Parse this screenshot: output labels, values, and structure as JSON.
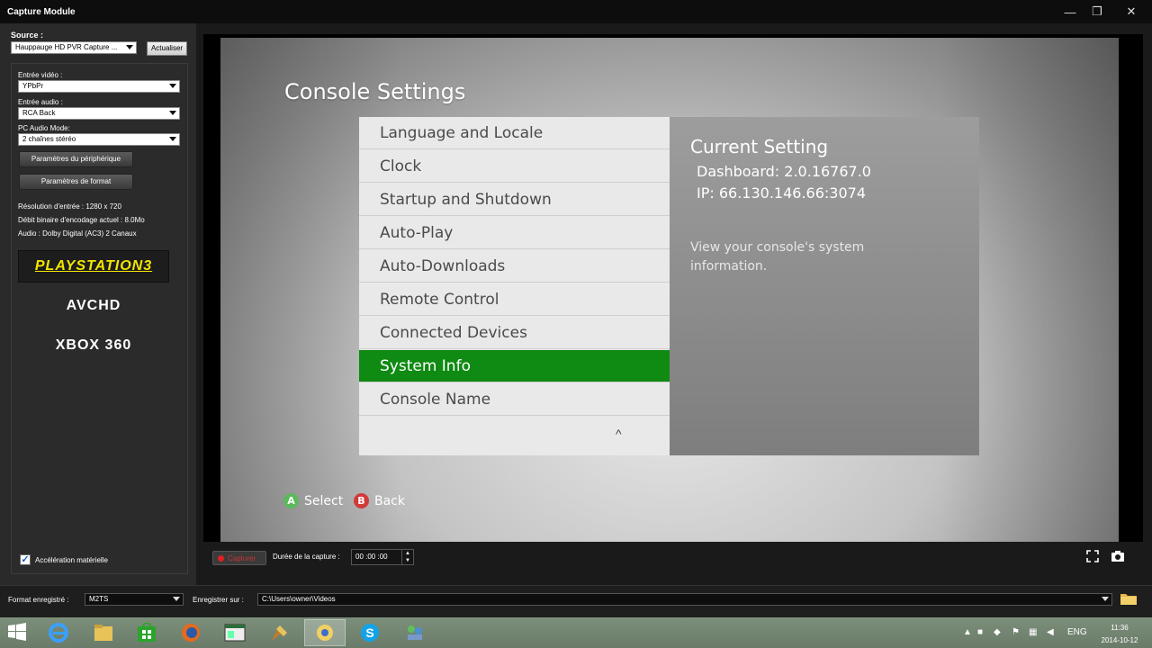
{
  "window": {
    "title": "Capture Module",
    "minimize": "—",
    "restore": "❐",
    "close": "✕"
  },
  "left_panel": {
    "source_label": "Source :",
    "source_value": "Hauppauge HD PVR Capture ...",
    "refresh_button": "Actualiser",
    "video_input_label": "Entrée vidéo :",
    "video_input_value": "YPbPr",
    "audio_input_label": "Entrée audio :",
    "audio_input_value": "RCA Back",
    "pc_audio_label": "PC Audio Mode:",
    "pc_audio_value": "2 chaînes stéréo",
    "device_params_button": "Paramètres du périphérique",
    "format_params_button": "Paramètres de format",
    "resolution_text": "Résolution d'entrée : 1280 x 720",
    "bitrate_text": "Débit binaire d'encodage actuel : 8.0Mo",
    "audio_text": "Audio : Dolby Digital (AC3) 2 Canaux",
    "presets": [
      "PLAYSTATION3",
      "AVCHD",
      "XBOX 360"
    ],
    "selected_preset_index": 0,
    "hw_accel_label": "Accélération matérielle",
    "hw_accel_checked": true
  },
  "console_screen": {
    "title": "Console Settings",
    "menu_items": [
      "Language and Locale",
      "Clock",
      "Startup and Shutdown",
      "Auto-Play",
      "Auto-Downloads",
      "Remote Control",
      "Connected Devices",
      "System Info",
      "Console Name"
    ],
    "active_index": 7,
    "scroll_indicator": "^",
    "current_setting_title": "Current Setting",
    "dashboard_line": "Dashboard: 2.0.16767.0",
    "ip_line": "IP: 66.130.146.66:3074",
    "description": "View your console's system information.",
    "hint_a_letter": "A",
    "hint_a_label": "Select",
    "hint_b_letter": "B",
    "hint_b_label": "Back",
    "colors": {
      "active": "#0f8a12",
      "a_button": "#5cb85c",
      "b_button": "#d23a3a"
    }
  },
  "capture_bar": {
    "capture_button": "Capturer",
    "duration_label": "Durée de la capture :",
    "duration_value": "00 :00 :00",
    "fullscreen_icon": "fullscreen-icon",
    "snapshot_icon": "camera-icon"
  },
  "footer": {
    "format_label": "Format enregistré :",
    "format_value": "M2TS",
    "save_label": "Enregistrer sur :",
    "save_path": "C:\\Users\\owner\\Videos"
  },
  "taskbar": {
    "apps": [
      "internet-explorer-icon",
      "file-explorer-icon",
      "store-icon",
      "firefox-icon",
      "window-app-icon",
      "paint-icon",
      "capture-app-icon",
      "skype-icon",
      "network-app-icon"
    ],
    "active_app_index": 6,
    "language": "ENG",
    "time": "11:36",
    "date": "2014-10-12"
  }
}
